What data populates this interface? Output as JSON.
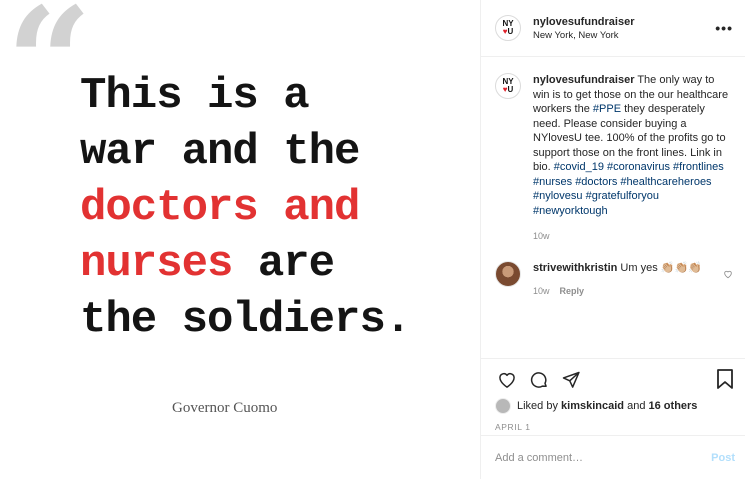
{
  "media": {
    "quote_mark": "“",
    "lines": [
      {
        "text": "This is a",
        "red": false
      },
      {
        "text": "war and the",
        "red": false
      },
      {
        "text": "doctors and",
        "red": true
      },
      {
        "pre_red": "nurses",
        "rest": " are"
      },
      {
        "text": "the soldiers.",
        "red": false
      }
    ],
    "attribution": "Governor Cuomo"
  },
  "header": {
    "logo_top": "NY",
    "logo_heart": "♥",
    "logo_bottom": "U",
    "username": "nylovesufundraiser",
    "location": "New York, New York",
    "more": "•••"
  },
  "caption": {
    "username": "nylovesufundraiser",
    "text": " The only way to win is to get those on the our healthcare workers the ",
    "tag_ppe": "#PPE",
    "text2": " they desperately need. Please consider buying a NYlovesU tee. 100% of the profits go to support those on the front lines. Link in bio. ",
    "tags": "#covid_19 #coronavirus #frontlines #nurses #doctors #healthcareheroes #nylovesu #gratefulforyou #newyorktough",
    "time": "10w"
  },
  "comment": {
    "username": "strivewithkristin",
    "text": " Um yes 👏🏼👏🏼👏🏼",
    "time": "10w",
    "reply": "Reply"
  },
  "actions": {
    "liked_by_prefix": "Liked by ",
    "liked_user": "kimskincaid",
    "and": " and ",
    "others": "16 others",
    "date": "APRIL 1"
  },
  "add_comment": {
    "placeholder": "Add a comment…",
    "post_label": "Post"
  }
}
